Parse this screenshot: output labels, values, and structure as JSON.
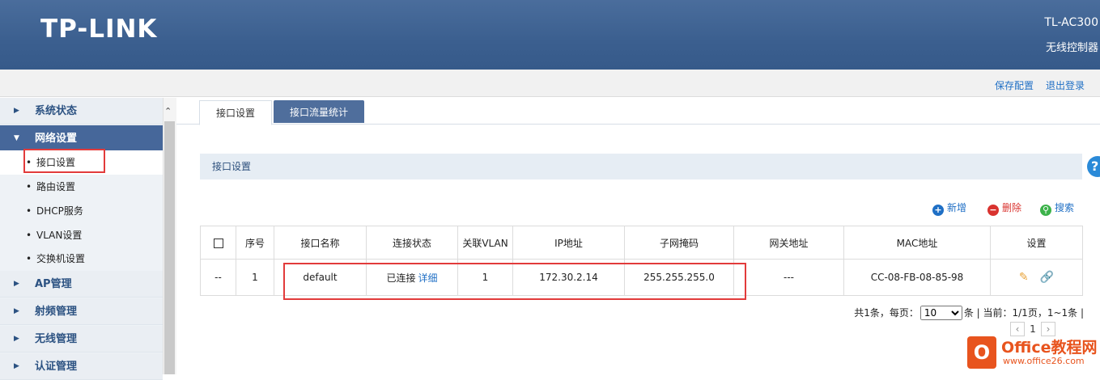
{
  "header": {
    "logo": "TP-LINK",
    "model": "TL-AC300",
    "subtitle": "无线控制器"
  },
  "toolbar": {
    "save_config": "保存配置",
    "logout": "退出登录"
  },
  "sidebar": {
    "groups": [
      {
        "label": "系统状态"
      },
      {
        "label": "网络设置"
      },
      {
        "label": "AP管理"
      },
      {
        "label": "射频管理"
      },
      {
        "label": "无线管理"
      },
      {
        "label": "认证管理"
      }
    ],
    "network_items": [
      {
        "label": "接口设置"
      },
      {
        "label": "路由设置"
      },
      {
        "label": "DHCP服务"
      },
      {
        "label": "VLAN设置"
      },
      {
        "label": "交换机设置"
      }
    ]
  },
  "tabs": [
    {
      "label": "接口设置"
    },
    {
      "label": "接口流量统计"
    }
  ],
  "section": {
    "title": "接口设置",
    "help": "?"
  },
  "actions": {
    "add": "新增",
    "delete": "删除",
    "search": "搜索"
  },
  "table": {
    "headers": [
      "序号",
      "接口名称",
      "连接状态",
      "关联VLAN",
      "IP地址",
      "子网掩码",
      "网关地址",
      "MAC地址",
      "设置"
    ],
    "rows": [
      {
        "check": "--",
        "index": "1",
        "name": "default",
        "status": "已连接",
        "detail": "详细",
        "vlan": "1",
        "ip": "172.30.2.14",
        "mask": "255.255.255.0",
        "gateway": "---",
        "mac": "CC-08-FB-08-85-98"
      }
    ]
  },
  "pager": {
    "summary_prefix": "共1条，每页：",
    "page_size": "10",
    "summary_suffix": "条 | 当前：1/1页，1~1条 |",
    "current": "1"
  },
  "watermark": {
    "logo": "O",
    "text": "Office教程网",
    "url": "www.office26.com"
  },
  "colors": {
    "header": "#3b5f8f",
    "accent": "#1f6fc5",
    "highlight": "#e23b3b"
  }
}
